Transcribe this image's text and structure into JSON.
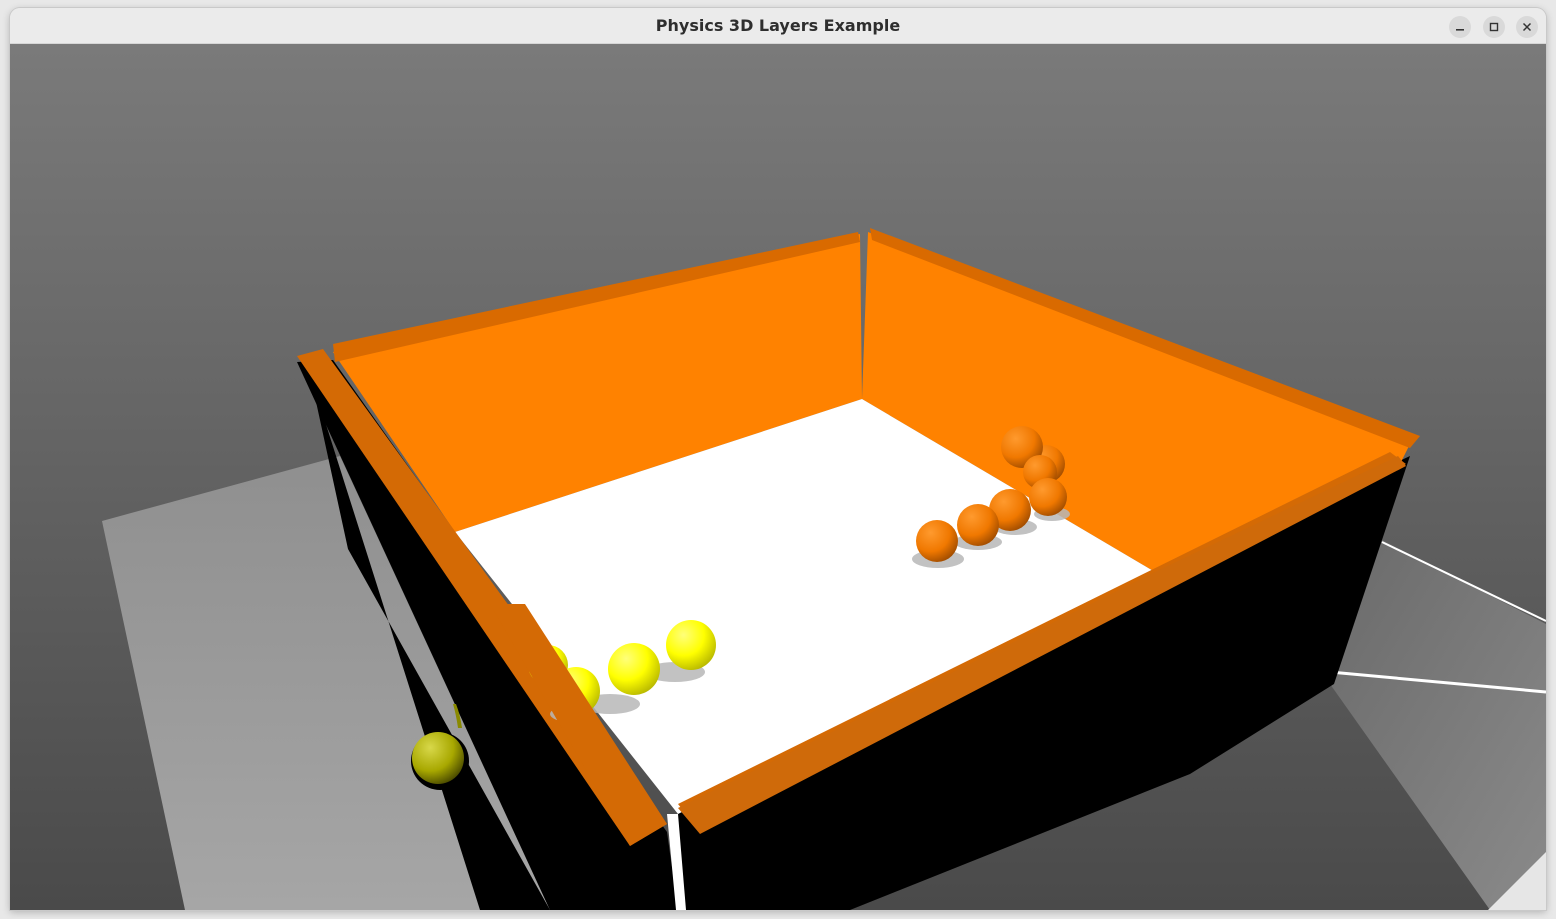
{
  "window": {
    "title": "Physics 3D Layers Example",
    "controls": {
      "minimize_icon": "minimize-icon",
      "maximize_icon": "maximize-icon",
      "close_icon": "close-icon"
    }
  },
  "scene": {
    "background_top_color": "#7a7a7a",
    "background_bottom_color": "#4c4c4c",
    "wall_color": "#ff8000",
    "wall_top_color": "#e07000",
    "floor_color": "#ffffff",
    "wall_shadow_color": "#000000",
    "ground_color": "#a0a0a0",
    "orange_ball_color": "#f07800",
    "yellow_ball_color": "#ffff00"
  }
}
